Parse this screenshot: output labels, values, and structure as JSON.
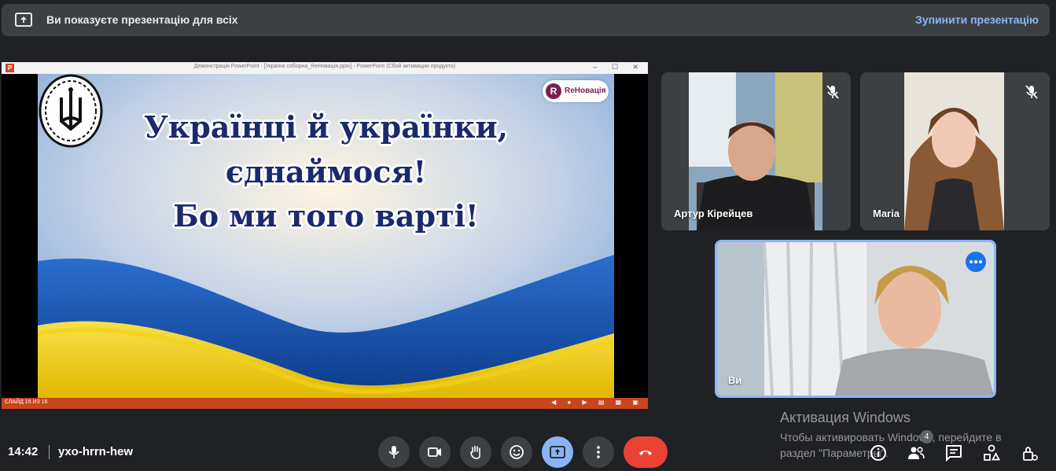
{
  "banner": {
    "message": "Ви показуєте презентацію для всіх",
    "stop_label": "Зупинити презентацію"
  },
  "powerpoint": {
    "window_title": "Демонстрація PowerPoint - [Україна соборна_ReHовація.pptx] - PowerPoint (Сбой активации продукта)",
    "slide_counter": "СЛАЙД 15 ИЗ 16",
    "slide": {
      "logo_text": "ReНовація",
      "line1": "Українці й українки,",
      "line2": "єднаймося!",
      "line3": "Бо ми того варті!"
    }
  },
  "participants": [
    {
      "name": "Артур Кірейцев",
      "muted": true
    },
    {
      "name": "Maria",
      "muted": true
    },
    {
      "name": "Ви",
      "muted": false
    }
  ],
  "watermark": {
    "title": "Активация Windows",
    "text": "Чтобы активировать Windows, перейдите в раздел \"Параметры\"."
  },
  "bottom_bar": {
    "time": "14:42",
    "meeting_code": "yxo-hrrn-hew",
    "people_count": "4"
  },
  "colors": {
    "background": "#202124",
    "accent": "#8ab4f8",
    "hangup": "#ea4335",
    "flag_blue": "#1c5fbf",
    "flag_yellow": "#f2d21a"
  }
}
